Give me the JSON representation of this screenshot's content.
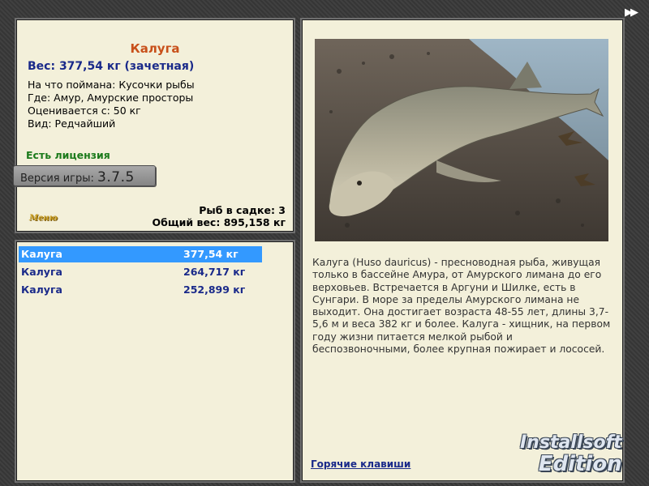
{
  "navigation": {
    "next_icon": "double-arrow-right-icon"
  },
  "fish": {
    "title": "Калуга",
    "weight_line": "Вес: 377,54 кг (зачетная)",
    "bait": "На что поймана: Кусочки рыбы",
    "location": "Где: Амур, Амурские просторы",
    "rating": "Оценивается с: 50 кг",
    "kind": "Вид: Редчайший",
    "license": "Есть лицензия"
  },
  "version": {
    "label": "Версия игры:",
    "number": "3.7.5"
  },
  "menu": {
    "label": "Меню"
  },
  "cage": {
    "count": "Рыб в садке: 3",
    "total_weight": "Общий вес: 895,158 кг"
  },
  "catches": [
    {
      "name": "Калуга",
      "weight": "377,54 кг",
      "selected": true
    },
    {
      "name": "Калуга",
      "weight": "264,717 кг",
      "selected": false
    },
    {
      "name": "Калуга",
      "weight": "252,899 кг",
      "selected": false
    }
  ],
  "description": "Калуга (Huso dauricus) - пресноводная рыба, живущая только в бассейне Амура, от Амурского лимана до его верховьев. Встречается в Аргуни и Шилке, есть в Сунгари. В море за пределы Амурского лимана не выходит. Она достигает возраста 48-55 лет, длины 3,7-5,6 м и веса 382 кг и более. Калуга - хищник, на первом году жизни питается мелкой рыбой и беспозвоночными, более крупная пожирает и лососей.",
  "hotkeys_link": "Горячие клавиши",
  "watermark": {
    "line1": "Installsoft",
    "line2": "Edition"
  },
  "colors": {
    "panel_bg": "#f3f0da",
    "title": "#c8501a",
    "accent_blue": "#1a2a8a",
    "license_green": "#1b7a1b",
    "selection": "#3399ff"
  }
}
